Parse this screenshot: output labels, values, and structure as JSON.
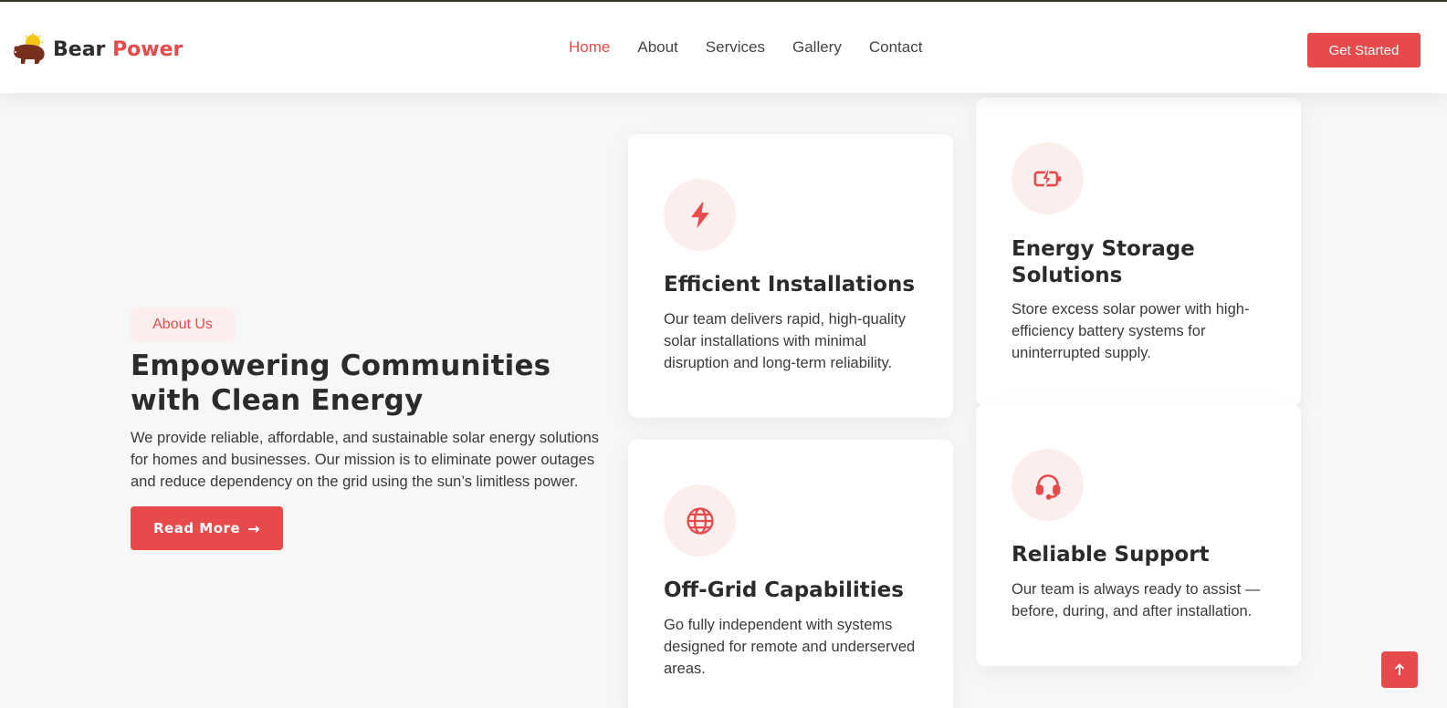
{
  "brand": {
    "name_part1": "Bear",
    "name_part2": "Power"
  },
  "nav": {
    "items": [
      {
        "label": "Home",
        "active": true
      },
      {
        "label": "About",
        "active": false
      },
      {
        "label": "Services",
        "active": false
      },
      {
        "label": "Gallery",
        "active": false
      },
      {
        "label": "Contact",
        "active": false
      }
    ],
    "cta_label": "Get Started"
  },
  "hero": {
    "badge": "About Us",
    "headline": "Empowering Communities with Clean Energy",
    "lead": "We provide reliable, affordable, and sustainable solar energy solutions for homes and businesses. Our mission is to eliminate power outages and reduce dependency on the grid using the sun’s limitless power.",
    "button_label": "Read More"
  },
  "cards": [
    {
      "icon": "lightning-icon",
      "title": "Efficient Installations",
      "text": "Our team delivers rapid, high-quality solar installations with minimal disruption and long-term reliability."
    },
    {
      "icon": "battery-charging-icon",
      "title": "Energy Storage Solutions",
      "text": "Store excess solar power with high-efficiency battery systems for uninterrupted supply."
    },
    {
      "icon": "globe-icon",
      "title": "Off-Grid Capabilities",
      "text": "Go fully independent with systems designed for remote and underserved areas."
    },
    {
      "icon": "headset-icon",
      "title": "Reliable Support",
      "text": "Our team is always ready to assist — before, during, and after installation."
    }
  ],
  "colors": {
    "accent": "#e74a4a",
    "accent_soft": "#fdeeee",
    "text_dark": "#2b2b2b",
    "background": "#f7f7f7"
  }
}
